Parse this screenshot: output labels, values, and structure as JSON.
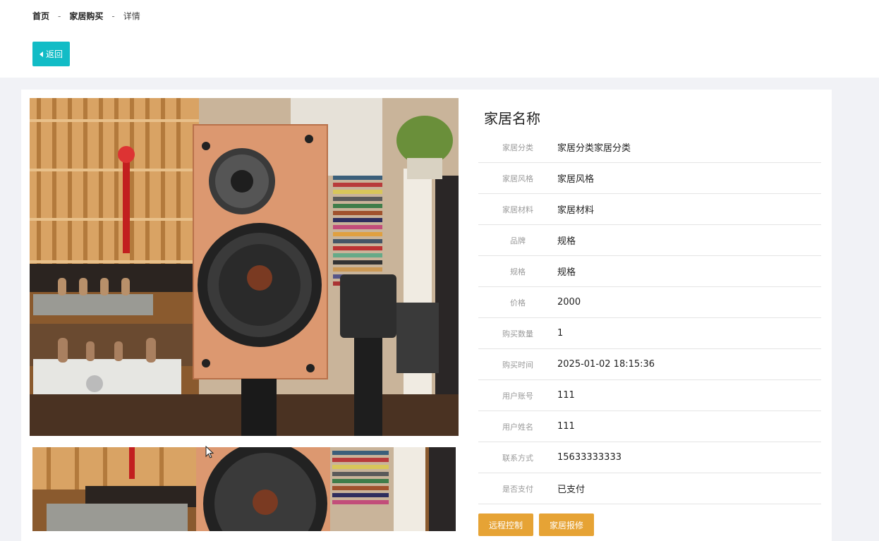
{
  "breadcrumb": {
    "home": "首页",
    "section": "家居购买",
    "current": "详情",
    "separator": "-"
  },
  "back_button": {
    "label": "返回",
    "icon": "caret-left-icon"
  },
  "colors": {
    "accent": "#12bcc6",
    "action": "#e6a335",
    "background": "#f1f2f6"
  },
  "detail": {
    "title": "家居名称",
    "rows": [
      {
        "label": "家居分类",
        "value": "家居分类家居分类"
      },
      {
        "label": "家居风格",
        "value": "家居风格"
      },
      {
        "label": "家居材料",
        "value": "家居材料"
      },
      {
        "label": "品牌",
        "value": "规格"
      },
      {
        "label": "规格",
        "value": "规格"
      },
      {
        "label": "价格",
        "value": "2000"
      },
      {
        "label": "购买数量",
        "value": "1"
      },
      {
        "label": "购买时间",
        "value": "2025-01-02 18:15:36"
      },
      {
        "label": "用户账号",
        "value": "111"
      },
      {
        "label": "用户姓名",
        "value": "111"
      },
      {
        "label": "联系方式",
        "value": "15633333333"
      },
      {
        "label": "是否支付",
        "value": "已支付"
      }
    ]
  },
  "actions": {
    "remote_control": "远程控制",
    "repair": "家居报修"
  },
  "images": {
    "main": "speaker-photo",
    "thumbnail": "speaker-thumbnail"
  }
}
